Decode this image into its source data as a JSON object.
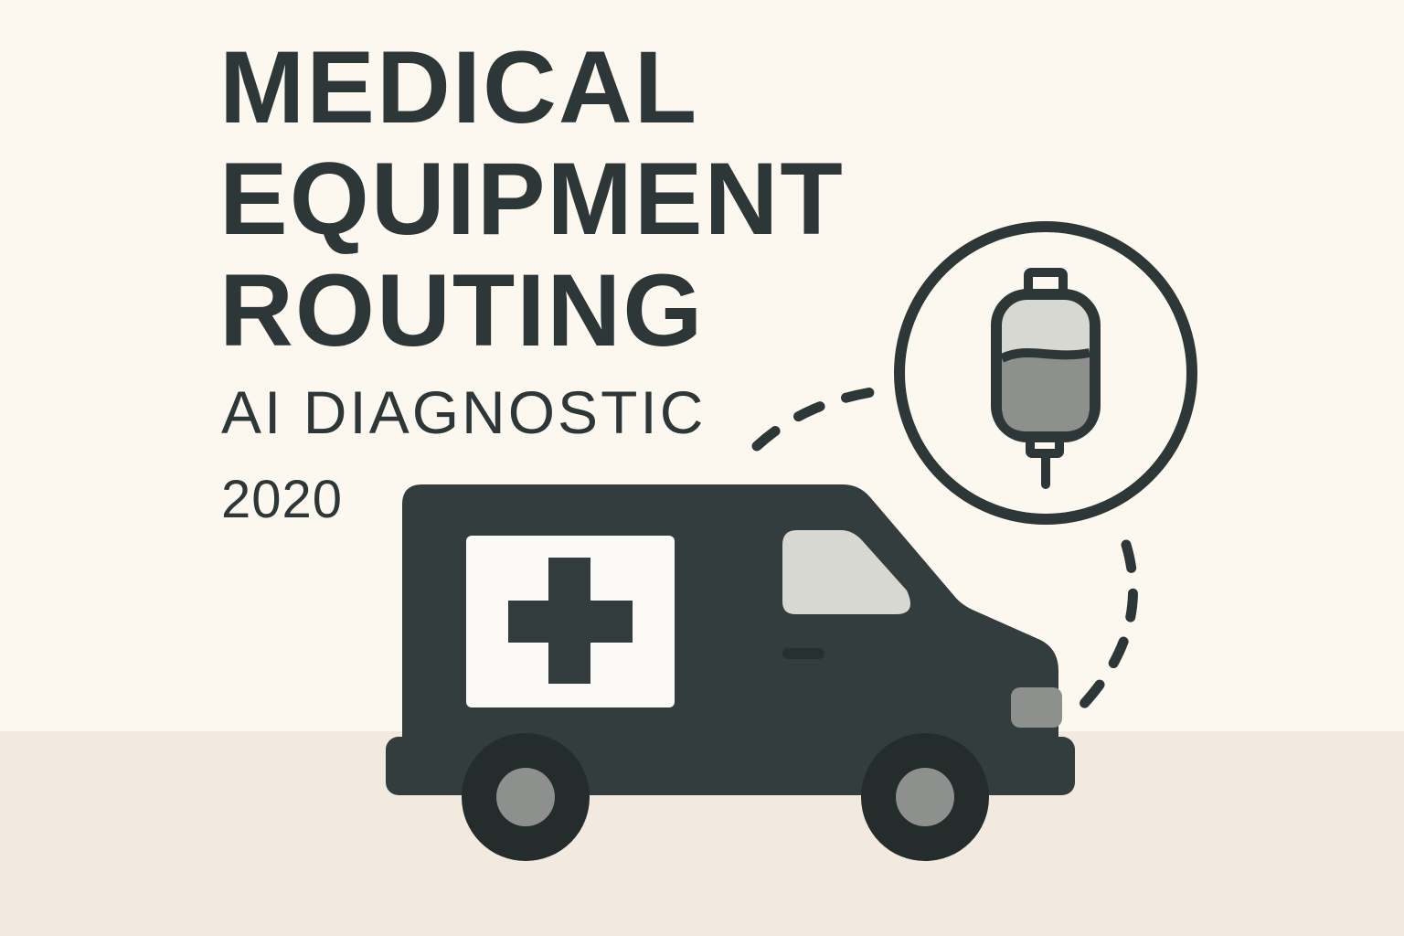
{
  "title_lines": [
    "MEDICAL",
    "EQUIPMENT",
    "ROUTING"
  ],
  "subtitle": "AI DIAGNOSTIC",
  "year": "2020",
  "icons": {
    "vehicle": "ambulance-icon",
    "badge": "medical-cross-icon",
    "equipment": "iv-bag-icon"
  },
  "colors": {
    "background": "#fcf8f0",
    "ground": "#f2eadf",
    "ink": "#2e3737",
    "light_gray": "#d8d8d2",
    "mid_gray": "#8e908e"
  }
}
